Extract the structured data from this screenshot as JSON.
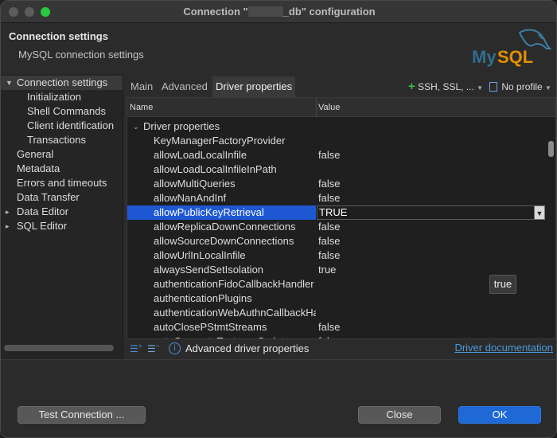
{
  "window": {
    "title_prefix": "Connection \"",
    "title_suffix": "_db\" configuration"
  },
  "header": {
    "title": "Connection settings",
    "subtitle": "MySQL connection settings",
    "logo_text": "MySQL"
  },
  "sidebar": {
    "items": [
      {
        "label": "Connection settings",
        "expanded": true,
        "selected": true
      },
      {
        "label": "Initialization"
      },
      {
        "label": "Shell Commands"
      },
      {
        "label": "Client identification"
      },
      {
        "label": "Transactions"
      },
      {
        "label": "General"
      },
      {
        "label": "Metadata"
      },
      {
        "label": "Errors and timeouts"
      },
      {
        "label": "Data Transfer"
      },
      {
        "label": "Data Editor",
        "collapsed": true
      },
      {
        "label": "SQL Editor",
        "collapsed": true
      }
    ]
  },
  "tabs": [
    {
      "label": "Main"
    },
    {
      "label": "Advanced"
    },
    {
      "label": "Driver properties",
      "active": true
    }
  ],
  "toolbar": {
    "network_label": "SSH, SSL, ...",
    "profile_label": "No profile"
  },
  "table": {
    "columns": [
      "Name",
      "Value"
    ],
    "group_label": "Driver properties",
    "rows": [
      {
        "name": "KeyManagerFactoryProvider",
        "value": ""
      },
      {
        "name": "allowLoadLocalInfile",
        "value": "false"
      },
      {
        "name": "allowLoadLocalInfileInPath",
        "value": ""
      },
      {
        "name": "allowMultiQueries",
        "value": "false"
      },
      {
        "name": "allowNanAndInf",
        "value": "false"
      },
      {
        "name": "allowPublicKeyRetrieval",
        "value": "TRUE",
        "selected": true
      },
      {
        "name": "allowReplicaDownConnections",
        "value": "false"
      },
      {
        "name": "allowSourceDownConnections",
        "value": "false"
      },
      {
        "name": "allowUrlInLocalInfile",
        "value": "false"
      },
      {
        "name": "alwaysSendSetIsolation",
        "value": "true"
      },
      {
        "name": "authenticationFidoCallbackHandler",
        "value": ""
      },
      {
        "name": "authenticationPlugins",
        "value": ""
      },
      {
        "name": "authenticationWebAuthnCallbackHandler",
        "value": ""
      },
      {
        "name": "autoClosePStmtStreams",
        "value": "false"
      },
      {
        "name": "autoGenerateTestcaseScript",
        "value": "false"
      }
    ],
    "dropdown_option": "true"
  },
  "footer": {
    "advanced_label": "Advanced driver properties",
    "doc_link": "Driver documentation"
  },
  "buttons": {
    "test": "Test Connection ...",
    "close": "Close",
    "ok": "OK"
  },
  "colors": {
    "selection": "#1d57d2",
    "primary_button": "#1e69d6",
    "mysql_blue": "#2f6f8f",
    "mysql_orange": "#e48e00"
  }
}
